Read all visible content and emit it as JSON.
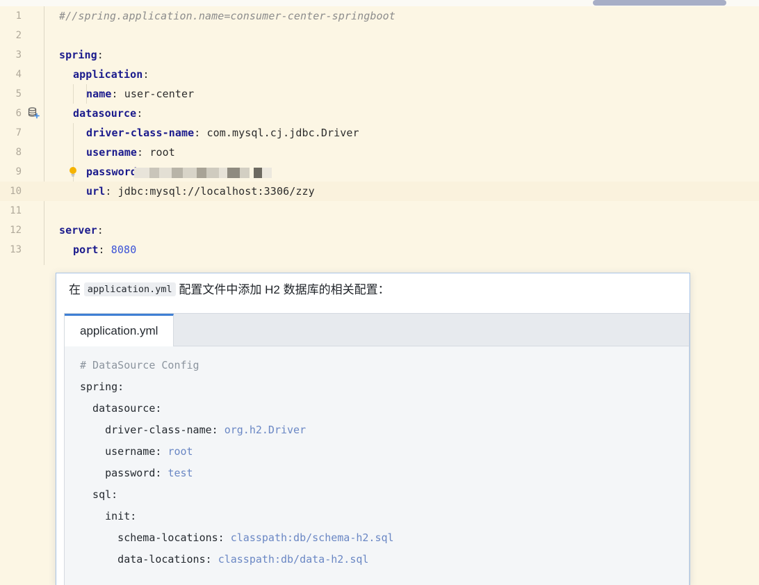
{
  "window": {
    "background_color": "#fcf6e4",
    "scrollbar": {
      "name": "horizontal-scrollbar",
      "thumb_color": "#a7aec6"
    }
  },
  "editor": {
    "language": "yaml",
    "gutter_icons": [
      {
        "line": 6,
        "icon": "database-add-icon"
      },
      {
        "line": 9,
        "icon": "lightbulb-intention-icon"
      }
    ],
    "highlighted_line": 10,
    "lines": [
      {
        "no": "1",
        "text": "#//spring.application.name=consumer-center-springboot",
        "kind": "comment"
      },
      {
        "no": "2",
        "text": "",
        "kind": "blank"
      },
      {
        "no": "3",
        "text": "spring:",
        "kind": "key",
        "key": "spring",
        "indent": 0
      },
      {
        "no": "4",
        "text": "  application:",
        "kind": "key",
        "key": "application",
        "indent": 1
      },
      {
        "no": "5",
        "text": "    name: user-center",
        "kind": "pair",
        "key": "name",
        "value": "user-center",
        "indent": 2
      },
      {
        "no": "6",
        "text": "  datasource:",
        "kind": "key",
        "key": "datasource",
        "indent": 1
      },
      {
        "no": "7",
        "text": "    driver-class-name: com.mysql.cj.jdbc.Driver",
        "kind": "pair",
        "key": "driver-class-name",
        "value": "com.mysql.cj.jdbc.Driver",
        "indent": 2
      },
      {
        "no": "8",
        "text": "    username: root",
        "kind": "pair",
        "key": "username",
        "value": "root",
        "indent": 2
      },
      {
        "no": "9",
        "text": "    password: ",
        "kind": "pair-masked",
        "key": "password",
        "value": "",
        "indent": 2
      },
      {
        "no": "10",
        "text": "    url: jdbc:mysql://localhost:3306/zzy",
        "kind": "pair",
        "key": "url",
        "value": "jdbc:mysql://localhost:3306/zzy",
        "indent": 2
      },
      {
        "no": "11",
        "text": "",
        "kind": "blank"
      },
      {
        "no": "12",
        "text": "server:",
        "kind": "key",
        "key": "server",
        "indent": 0
      },
      {
        "no": "13",
        "text": "  port: 8080",
        "kind": "pair-num",
        "key": "port",
        "value": "8080",
        "indent": 1
      }
    ]
  },
  "popup": {
    "name": "assistant-suggestion-popup",
    "intro_prefix": "在",
    "intro_code_chip": "application.yml",
    "intro_suffix": "配置文件中添加 H2 数据库的相关配置：",
    "code_card": {
      "tab_label": "application.yml",
      "lines": [
        {
          "text": "# DataSource Config",
          "type": "comment"
        },
        {
          "text": "spring:",
          "type": "plain"
        },
        {
          "text": "  datasource:",
          "type": "plain"
        },
        {
          "text": "    driver-class-name: ",
          "value": "org.h2.Driver",
          "type": "pair"
        },
        {
          "text": "    username: ",
          "value": "root",
          "type": "pair"
        },
        {
          "text": "    password: ",
          "value": "test",
          "type": "pair"
        },
        {
          "text": "  sql:",
          "type": "plain"
        },
        {
          "text": "    init:",
          "type": "plain"
        },
        {
          "text": "      schema-locations: ",
          "value": "classpath:db/schema-h2.sql",
          "type": "pair"
        },
        {
          "text": "      data-locations: ",
          "value": "classpath:db/data-h2.sql",
          "type": "pair"
        }
      ]
    }
  },
  "colors": {
    "editor_bg": "#fcf6e4",
    "key": "#1a1a8c",
    "number": "#3b52d6",
    "comment": "#8c8c8c",
    "popup_border": "#a8c4e6",
    "tab_accent": "#3f7fd4",
    "code_value": "#6a87c4"
  }
}
